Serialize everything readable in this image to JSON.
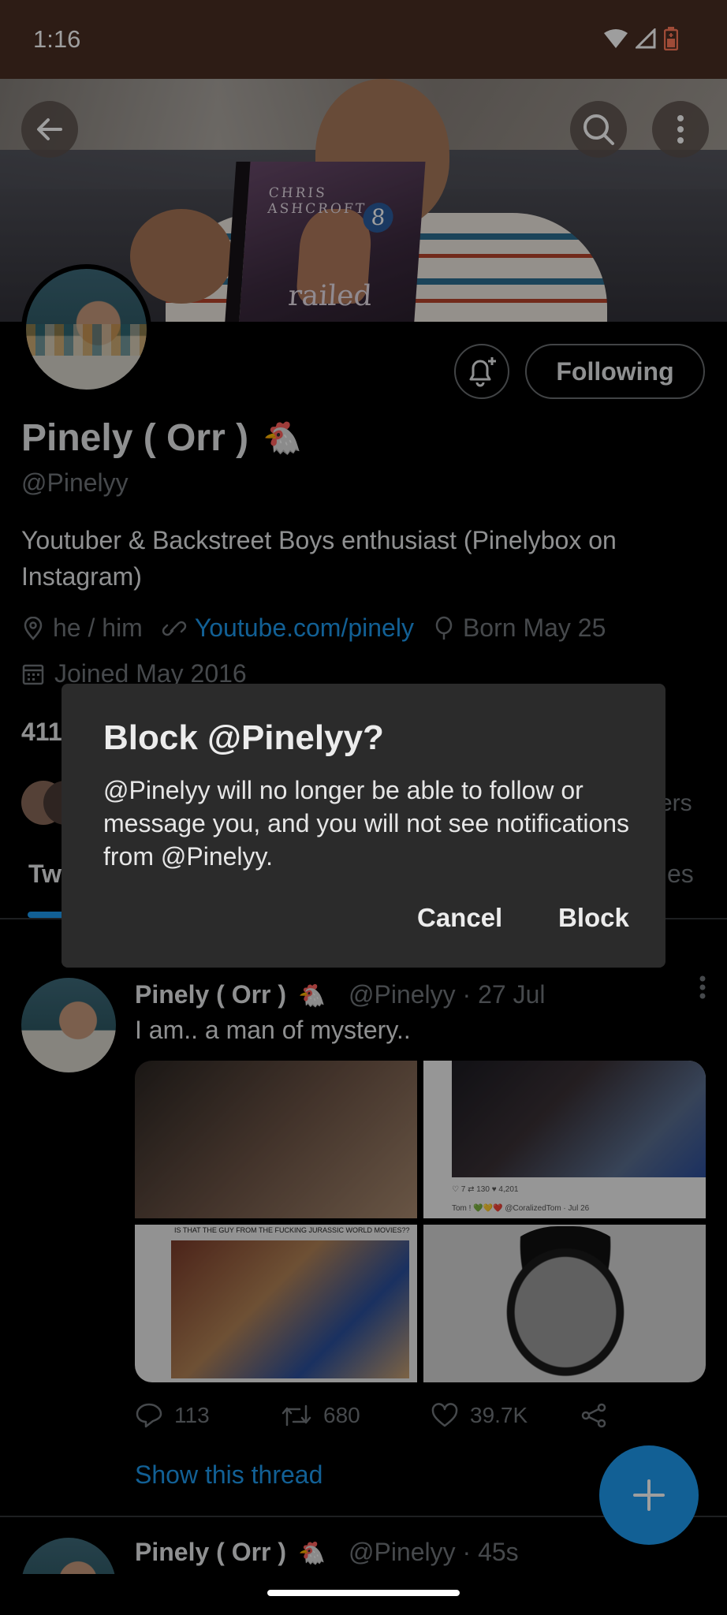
{
  "status_bar": {
    "time": "1:16"
  },
  "profile": {
    "name": "Pinely ( Orr )",
    "emoji": "🐔",
    "handle": "@Pinelyy",
    "bio": "Youtuber & Backstreet Boys enthusiast (Pinelybox on Instagram)",
    "pronouns": "he / him",
    "link": "Youtube.com/pinely",
    "birthday": "Born May 25",
    "joined": "Joined May 2016",
    "following_button": "Following",
    "stats_fragment": "411",
    "followers_fragment": "ers",
    "tab_left_fragment": "Tw",
    "tab_right_fragment": "es"
  },
  "banner_book": {
    "author": "CHRIS ASHCROFT",
    "title": "railed",
    "number": "8"
  },
  "dialog": {
    "title": "Block @Pinelyy?",
    "message": "@Pinelyy will no longer be able to follow or message you, and you will not see notifications from @Pinelyy.",
    "cancel_label": "Cancel",
    "confirm_label": "Block"
  },
  "tweets": [
    {
      "name": "Pinely ( Orr )",
      "emoji": "🐔",
      "meta": "@Pinelyy · 27 Jul",
      "text": "I am.. a man of mystery..",
      "replies": "113",
      "retweets": "680",
      "likes": "39.7K",
      "show_thread": "Show this thread",
      "media": {
        "img2_stats": "♡ 7     ⇄ 130     ♥ 4,201",
        "img2_caption": "Tom ! 💚💛❤️ @CoralizedTom · Jul 26",
        "img3_caption": "IS THAT THE GUY FROM THE FUCKING JURASSIC WORLD MOVIES??"
      }
    },
    {
      "name": "Pinely ( Orr )",
      "emoji": "🐔",
      "meta": "@Pinelyy · 45s"
    }
  ],
  "colors": {
    "accent": "#1d9bf0",
    "status_bar": "#4a2e22",
    "dialog_bg": "#2b2b2b"
  }
}
